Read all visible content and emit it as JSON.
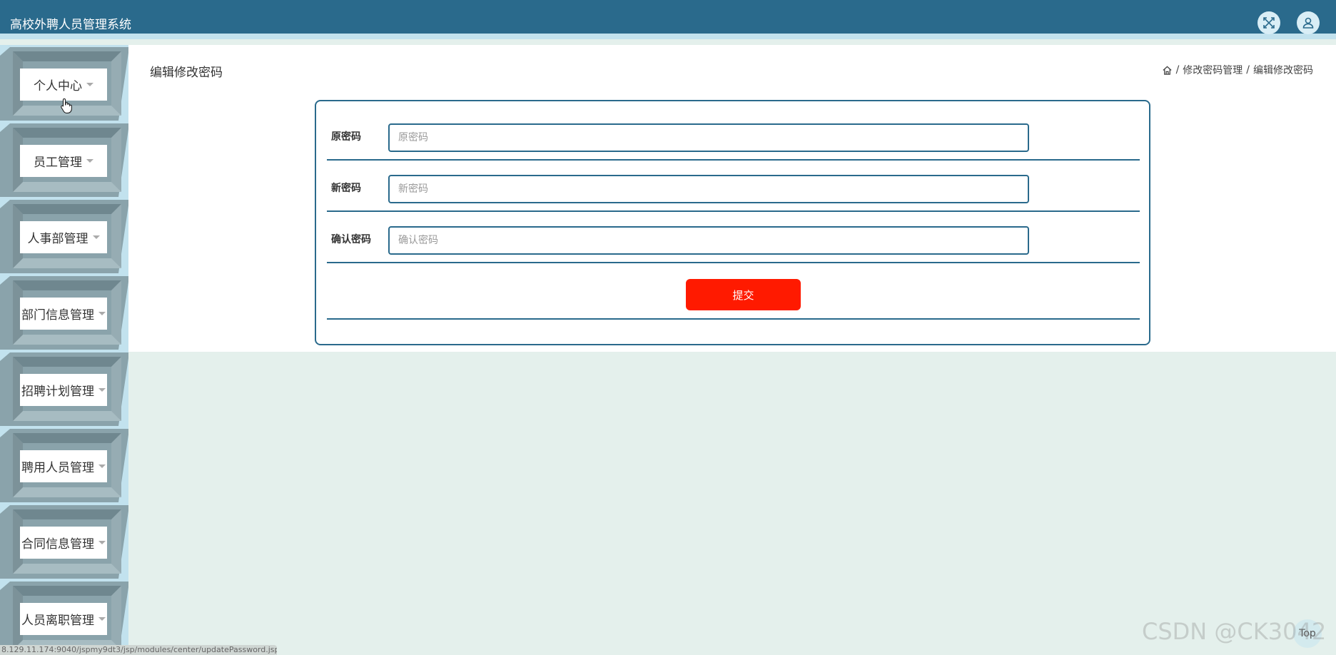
{
  "header": {
    "title": "高校外聘人员管理系统",
    "icons": [
      "fullscreen-icon",
      "user-icon"
    ]
  },
  "sidebar": {
    "items": [
      {
        "label": "个人中心"
      },
      {
        "label": "员工管理"
      },
      {
        "label": "人事部管理"
      },
      {
        "label": "部门信息管理"
      },
      {
        "label": "招聘计划管理"
      },
      {
        "label": "聘用人员管理"
      },
      {
        "label": "合同信息管理"
      },
      {
        "label": "人员离职管理"
      }
    ]
  },
  "main": {
    "page_title": "编辑修改密码",
    "breadcrumb": {
      "separator": "/",
      "items": [
        "修改密码管理",
        "编辑修改密码"
      ]
    },
    "form": {
      "fields": [
        {
          "label": "原密码",
          "placeholder": "原密码",
          "value": ""
        },
        {
          "label": "新密码",
          "placeholder": "新密码",
          "value": ""
        },
        {
          "label": "确认密码",
          "placeholder": "确认密码",
          "value": ""
        }
      ],
      "submit_label": "提交"
    }
  },
  "status_bar": {
    "url": "8.129.11.174:9040/jspmy9dt3/jsp/modules/center/updatePassword.jsp#"
  },
  "watermark": "CSDN @CK3042",
  "back_to_top_label": "Top",
  "colors": {
    "header": "#2a6a8c",
    "accent_light": "#c2e2ee",
    "frame_dark": "#7f969e",
    "submit": "#ff1a00",
    "background": "#e4f0ec"
  }
}
